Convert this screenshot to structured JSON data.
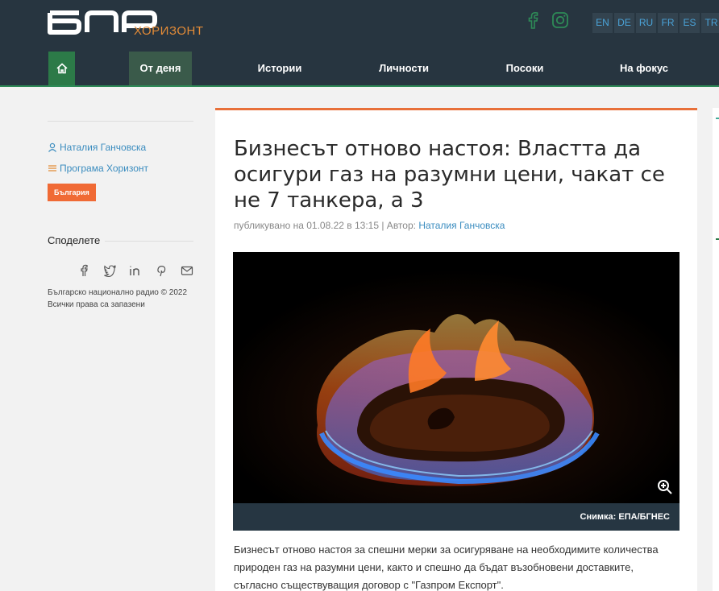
{
  "header": {
    "logo_sub": "ХОРИЗОНТ",
    "languages": [
      "EN",
      "DE",
      "RU",
      "FR",
      "ES",
      "TR"
    ],
    "social_icons": [
      "facebook-icon",
      "instagram-icon"
    ],
    "nav": [
      "От деня",
      "Истории",
      "Личности",
      "Посоки",
      "На фокус"
    ],
    "active_nav": "От деня"
  },
  "sidebar": {
    "author_link": "Наталия Ганчовска",
    "program_link": "Програма Хоризонт",
    "tag": "България",
    "share_title": "Споделете",
    "share_icons": [
      "facebook-icon",
      "twitter-icon",
      "linkedin-icon",
      "pinterest-icon",
      "email-icon"
    ],
    "copyright": "Българско национално радио © 2022 Всички права са запазени"
  },
  "article": {
    "title": "Бизнесът отново настоя: Властта да осигури газ на разумни цени, чакат се не 7 танкера, а 3",
    "meta_prefix": "публикувано на 01.08.22 в 13:15 | Автор:",
    "meta_author": "Наталия Ганчовска",
    "photo_caption": "Снимка: ЕПА/БГНЕС",
    "body": "Бизнесът отново настоя за спешни мерки за осигуряване на необходимите количества природен газ на разумни цени, както и спешно да бъдат възобновени доставките, съгласно съществуващия договор с \"Газпром Експорт\"."
  },
  "colors": {
    "header_bg": "#273540",
    "accent_orange": "#e8703a",
    "link_blue": "#3a8cbf",
    "home_green": "#2c7a48"
  }
}
